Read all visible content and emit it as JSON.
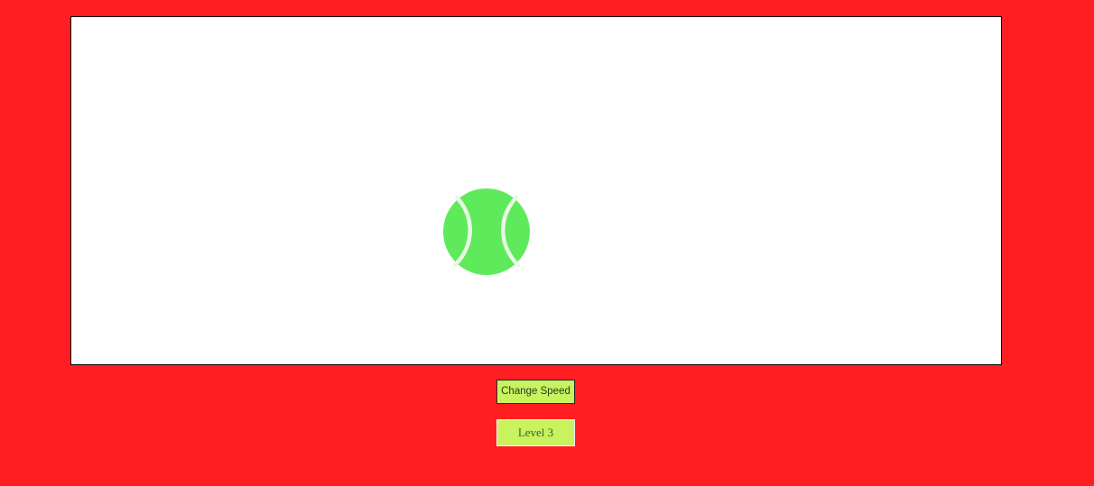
{
  "game": {
    "ball_icon": "tennis-ball-icon",
    "colors": {
      "page_background": "#ff1f23",
      "ball": "#5fea5c",
      "ball_seam": "#e9f7e6",
      "button_background": "#c8f25e"
    }
  },
  "controls": {
    "change_speed_label": "Change Speed",
    "level_label": "Level 3"
  }
}
